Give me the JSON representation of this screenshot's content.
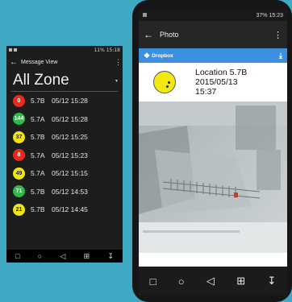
{
  "left_phone": {
    "status": {
      "time": "15:18",
      "battery": "11%"
    },
    "appbar": {
      "back": "←",
      "title": "Message View",
      "menu": "⋮"
    },
    "heading": {
      "title": "All Zone",
      "dropdown": "▾"
    },
    "rows": [
      {
        "badge": "0",
        "color": "red",
        "zone": "5.7B",
        "time": "05/12 15:28"
      },
      {
        "badge": "144",
        "color": "green",
        "zone": "5.7A",
        "time": "05/12 15:28"
      },
      {
        "badge": "37",
        "color": "yellow",
        "zone": "5.7B",
        "time": "05/12 15:25"
      },
      {
        "badge": "8",
        "color": "red",
        "zone": "5.7A",
        "time": "05/12 15:23"
      },
      {
        "badge": "49",
        "color": "yellow",
        "zone": "5.7A",
        "time": "05/12 15:15"
      },
      {
        "badge": "71",
        "color": "green",
        "zone": "5.7B",
        "time": "05/12 14:53"
      },
      {
        "badge": "21",
        "color": "yellow",
        "zone": "5.7B",
        "time": "05/12 14:45"
      }
    ],
    "navbar": [
      "□",
      "○",
      "◁",
      "⊞",
      "↧"
    ]
  },
  "right_phone": {
    "status": {
      "time": "15:23",
      "battery": "37%"
    },
    "appbar": {
      "back": "←",
      "title": "Photo",
      "menu": "⋮"
    },
    "dropbox": {
      "label": "Dropbox",
      "icon": "dropbox-icon",
      "download": "⤓"
    },
    "info": {
      "text": "Location 5.7B\n2015/05/13\n15:37"
    },
    "navbar": [
      "□",
      "○",
      "◁",
      "⊞",
      "↧"
    ]
  },
  "colors": {
    "background": "#3fa9c4",
    "red": "#e82a1c",
    "yellow": "#f1e51a",
    "green": "#2fb84b",
    "dropbox_blue": "#3d8fe0"
  }
}
